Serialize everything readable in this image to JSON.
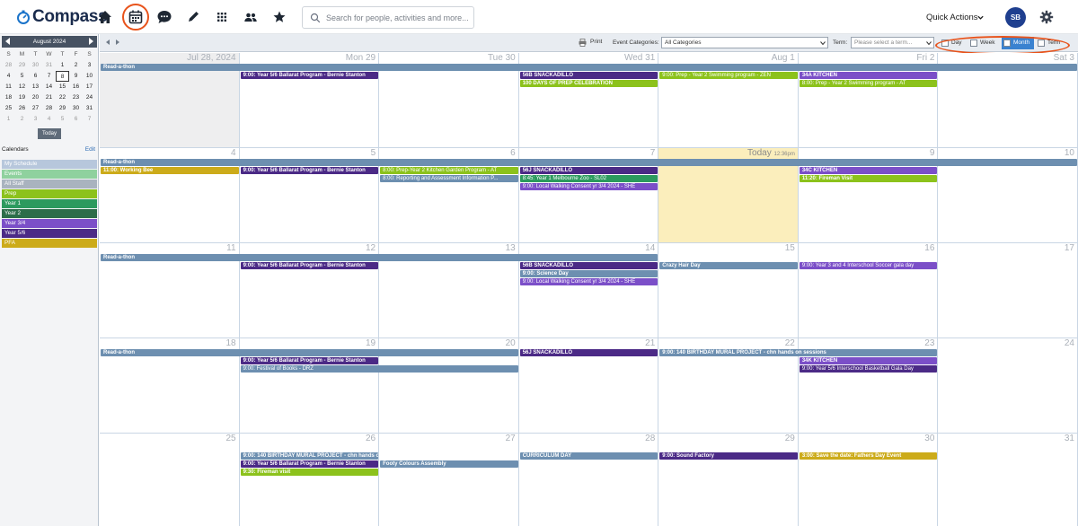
{
  "app": {
    "name": "Compass"
  },
  "search": {
    "placeholder": "Search for people, activities and more..."
  },
  "header": {
    "quick_actions": "Quick Actions",
    "avatar_initials": "SB"
  },
  "mini_cal": {
    "title": "August 2024",
    "dow": [
      "S",
      "M",
      "T",
      "W",
      "T",
      "F",
      "S"
    ],
    "weeks": [
      [
        "28",
        "29",
        "30",
        "31",
        "1",
        "2",
        "3"
      ],
      [
        "4",
        "5",
        "6",
        "7",
        "8",
        "9",
        "10"
      ],
      [
        "11",
        "12",
        "13",
        "14",
        "15",
        "16",
        "17"
      ],
      [
        "18",
        "19",
        "20",
        "21",
        "22",
        "23",
        "24"
      ],
      [
        "25",
        "26",
        "27",
        "28",
        "29",
        "30",
        "31"
      ],
      [
        "1",
        "2",
        "3",
        "4",
        "5",
        "6",
        "7"
      ]
    ],
    "today_label": "Today"
  },
  "calendars": {
    "title": "Calendars",
    "edit": "Edit",
    "items": [
      {
        "label": "My Schedule",
        "color": "#b7c7dc"
      },
      {
        "label": "Events",
        "color": "#8fd19e"
      },
      {
        "label": "All Staff",
        "color": "#a9b3bf"
      },
      {
        "label": "Prep",
        "color": "#8cc21c"
      },
      {
        "label": "Year 1",
        "color": "#2c9a5e"
      },
      {
        "label": "Year 2",
        "color": "#2c6d4a"
      },
      {
        "label": "Year 3/4",
        "color": "#7b4fc8"
      },
      {
        "label": "Year 5/6",
        "color": "#4b2a86"
      },
      {
        "label": "PFA",
        "color": "#ccab1a"
      }
    ]
  },
  "toolbar": {
    "print": "Print",
    "event_categories_label": "Event Categories:",
    "event_categories_value": "All Categories",
    "term_label": "Term:",
    "term_placeholder": "Please select a term...",
    "views": [
      "Day",
      "Week",
      "Month",
      "Term"
    ],
    "active_view": "Month"
  },
  "colors": {
    "event_bar": "#6d8fb0",
    "year56": "#4b2a86",
    "year34": "#7b4fc8",
    "prep": "#8cc21c",
    "pfa": "#ccab1a",
    "year1": "#2c9a5e",
    "accent_ring": "#e8531b"
  },
  "month": {
    "today_label": "Today",
    "today_time": "12:36pm",
    "weeks": [
      {
        "days": [
          "Jul 28, 2024",
          "Mon 29",
          "Tue 30",
          "Wed 31",
          "Aug 1",
          "Fri 2",
          "Sat 3"
        ],
        "other_month": [
          0
        ],
        "today": -1,
        "events": [
          {
            "text": "Read-a-thon",
            "color": "#6d8fb0",
            "start": 0,
            "span": 7,
            "row": 0
          },
          {
            "text": "9:00: Year 5/6 Ballarat Program - Bernie Stanton",
            "color": "#4b2a86",
            "start": 1,
            "span": 1,
            "row": 1
          },
          {
            "text": "56B SNACKADILLO",
            "color": "#4b2a86",
            "start": 3,
            "span": 1,
            "row": 1
          },
          {
            "text": "100 DAYS OF PREP CELEBRATION",
            "color": "#8cc21c",
            "start": 3,
            "span": 1,
            "row": 2
          },
          {
            "text": "9:00: Prep - Year 2 Swimming program - ZEN",
            "color": "#8cc21c",
            "start": 4,
            "span": 1,
            "row": 1,
            "thin": true
          },
          {
            "text": "34A KITCHEN",
            "color": "#7b4fc8",
            "start": 5,
            "span": 1,
            "row": 1
          },
          {
            "text": "8:00: Prep - Year 2 Swimming program - AT",
            "color": "#8cc21c",
            "start": 5,
            "span": 1,
            "row": 2,
            "thin": true
          }
        ]
      },
      {
        "days": [
          "4",
          "5",
          "6",
          "7",
          "8",
          "9",
          "10"
        ],
        "other_month": [],
        "today": 4,
        "events": [
          {
            "text": "Read-a-thon",
            "color": "#6d8fb0",
            "start": 0,
            "span": 7,
            "row": 0
          },
          {
            "text": "11:00: Working Bee",
            "color": "#ccab1a",
            "start": 0,
            "span": 1,
            "row": 1
          },
          {
            "text": "9:00: Year 5/6 Ballarat Program - Bernie Stanton",
            "color": "#4b2a86",
            "start": 1,
            "span": 1,
            "row": 1
          },
          {
            "text": "8:00: Prep-Year 2 Kitchen Garden Program - AT",
            "color": "#8cc21c",
            "start": 2,
            "span": 1,
            "row": 1,
            "thin": true
          },
          {
            "text": "8:00: Reporting and Assessment Information P...",
            "color": "#6d8fb0",
            "start": 2,
            "span": 1,
            "row": 2,
            "thin": true
          },
          {
            "text": "56J SNACKADILLO",
            "color": "#4b2a86",
            "start": 3,
            "span": 1,
            "row": 1
          },
          {
            "text": "8:45: Year 1 Melbourne Zoo - SL02",
            "color": "#2c9a5e",
            "start": 3,
            "span": 1,
            "row": 2,
            "thin": true
          },
          {
            "text": "9:00: Local Walking Consent yr 3/4 2024 - SHE",
            "color": "#7b4fc8",
            "start": 3,
            "span": 1,
            "row": 3,
            "thin": true
          },
          {
            "text": "34C KITCHEN",
            "color": "#7b4fc8",
            "start": 5,
            "span": 1,
            "row": 1
          },
          {
            "text": "11:20: Fireman Visit",
            "color": "#8cc21c",
            "start": 5,
            "span": 1,
            "row": 2
          }
        ]
      },
      {
        "days": [
          "11",
          "12",
          "13",
          "14",
          "15",
          "16",
          "17"
        ],
        "other_month": [],
        "today": -1,
        "events": [
          {
            "text": "Read-a-thon",
            "color": "#6d8fb0",
            "start": 0,
            "span": 4,
            "row": 0
          },
          {
            "text": "9:00: Year 5/6 Ballarat Program - Bernie Stanton",
            "color": "#4b2a86",
            "start": 1,
            "span": 1,
            "row": 1
          },
          {
            "text": "56B SNACKADILLO",
            "color": "#4b2a86",
            "start": 3,
            "span": 1,
            "row": 1
          },
          {
            "text": "9:00: Science Day",
            "color": "#6d8fb0",
            "start": 3,
            "span": 1,
            "row": 2
          },
          {
            "text": "9:00: Local Walking Consent yr 3/4 2024 - SHE",
            "color": "#7b4fc8",
            "start": 3,
            "span": 1,
            "row": 3,
            "thin": true
          },
          {
            "text": "Crazy Hair Day",
            "color": "#6d8fb0",
            "start": 4,
            "span": 1,
            "row": 1
          },
          {
            "text": "9:00: Year 3 and 4 Interschool Soccer gala day",
            "color": "#7b4fc8",
            "start": 5,
            "span": 1,
            "row": 1,
            "thin": true
          }
        ]
      },
      {
        "days": [
          "18",
          "19",
          "20",
          "21",
          "22",
          "23",
          "24"
        ],
        "other_month": [],
        "today": -1,
        "events": [
          {
            "text": "Read-a-thon",
            "color": "#6d8fb0",
            "start": 0,
            "span": 3,
            "row": 0
          },
          {
            "text": "9:00: Year 5/6 Ballarat Program - Bernie Stanton",
            "color": "#4b2a86",
            "start": 1,
            "span": 1,
            "row": 1
          },
          {
            "text": "9:00: Festival of Books - DRZ",
            "color": "#6d8fb0",
            "start": 1,
            "span": 2,
            "row": 2,
            "thin": true
          },
          {
            "text": "56J SNACKADILLO",
            "color": "#4b2a86",
            "start": 3,
            "span": 1,
            "row": 0
          },
          {
            "text": "9:00: 140 BIRTHDAY MURAL PROJECT - chn hands on sessions",
            "color": "#6d8fb0",
            "start": 4,
            "span": 2,
            "row": 0
          },
          {
            "text": "34K KITCHEN",
            "color": "#7b4fc8",
            "start": 5,
            "span": 1,
            "row": 1
          },
          {
            "text": "9:00: Year 5/6 Interschool Basketball Gala Day",
            "color": "#4b2a86",
            "start": 5,
            "span": 1,
            "row": 2,
            "thin": true
          }
        ]
      },
      {
        "days": [
          "25",
          "26",
          "27",
          "28",
          "29",
          "30",
          "31"
        ],
        "other_month": [],
        "today": -1,
        "events": [
          {
            "text": "9:00: 140 BIRTHDAY MURAL PROJECT - chn hands on sessions",
            "color": "#6d8fb0",
            "start": 1,
            "span": 1,
            "row": 1
          },
          {
            "text": "9:00: Year 5/6 Ballarat Program - Bernie Stanton",
            "color": "#4b2a86",
            "start": 1,
            "span": 1,
            "row": 2
          },
          {
            "text": "9:30: Fireman visit",
            "color": "#8cc21c",
            "start": 1,
            "span": 1,
            "row": 3
          },
          {
            "text": "Footy Colours Assembly",
            "color": "#6d8fb0",
            "start": 2,
            "span": 1,
            "row": 2
          },
          {
            "text": "CURRICULUM DAY",
            "color": "#6d8fb0",
            "start": 3,
            "span": 1,
            "row": 1
          },
          {
            "text": "9:00: Sound Factory",
            "color": "#4b2a86",
            "start": 4,
            "span": 1,
            "row": 1
          },
          {
            "text": "3:00: Save the date: Fathers Day Event",
            "color": "#ccab1a",
            "start": 5,
            "span": 1,
            "row": 1
          }
        ]
      }
    ]
  }
}
